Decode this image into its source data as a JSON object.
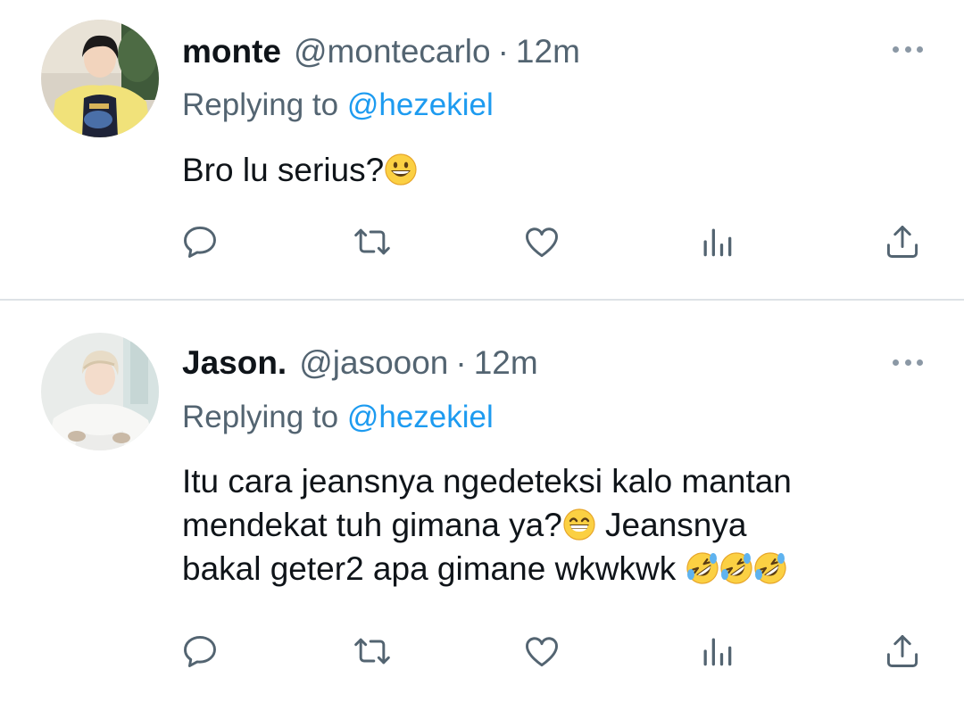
{
  "tweets": [
    {
      "display_name": "monte",
      "handle": "@montecarlo",
      "separator": "·",
      "time": "12m",
      "replying_prefix": "Replying to",
      "replying_to": "@hezekiel",
      "text": "Bro lu serius?",
      "emojis": [
        "grinning-face"
      ]
    },
    {
      "display_name": "Jason.",
      "handle": "@jasooon",
      "separator": "·",
      "time": "12m",
      "replying_prefix": "Replying to",
      "replying_to": "@hezekiel",
      "text_line1": "Itu cara jeansnya ngedeteksi kalo mantan",
      "text_line2_a": "mendekat tuh gimana ya?",
      "text_line2_b": " Jeansnya",
      "text_line3": "bakal geter2 apa gimane wkwkwk ",
      "emojis": [
        "beaming-face",
        "rofl-face",
        "rofl-face",
        "rofl-face"
      ]
    }
  ],
  "actions": [
    "reply-icon",
    "retweet-icon",
    "like-icon",
    "views-icon",
    "share-icon"
  ],
  "colors": {
    "text": "#0f1419",
    "secondary": "#536471",
    "link": "#1d9bf0",
    "divider": "#dde2e6",
    "icon": "#536471"
  }
}
